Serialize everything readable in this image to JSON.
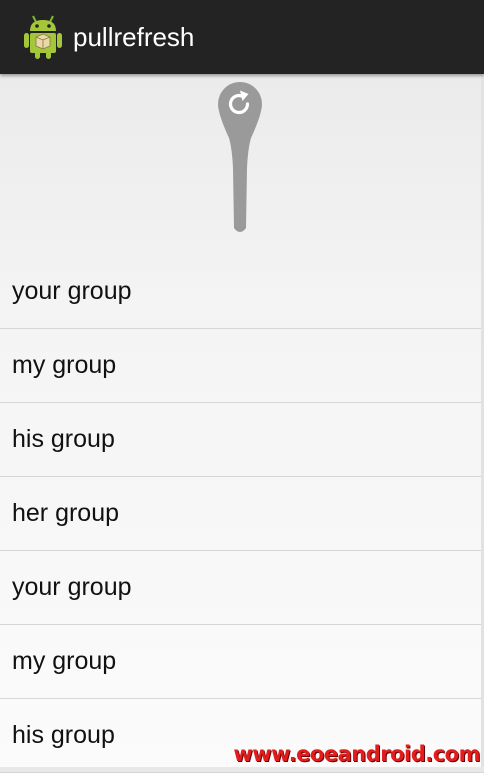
{
  "app": {
    "title": "pullrefresh",
    "icon": "android-robot-icon"
  },
  "refresh": {
    "indicator_icon": "refresh-icon"
  },
  "list": {
    "items": [
      {
        "label": "your group"
      },
      {
        "label": "my group"
      },
      {
        "label": "his group"
      },
      {
        "label": "her group"
      },
      {
        "label": "your group"
      },
      {
        "label": "my group"
      },
      {
        "label": "his group"
      }
    ]
  },
  "watermark": "www.eoeandroid.com",
  "colors": {
    "action_bar": "#232323",
    "list_text": "#111111",
    "divider": "#d6d6d6",
    "indicator": "#9a9a9a",
    "watermark": "#e21d1d"
  }
}
